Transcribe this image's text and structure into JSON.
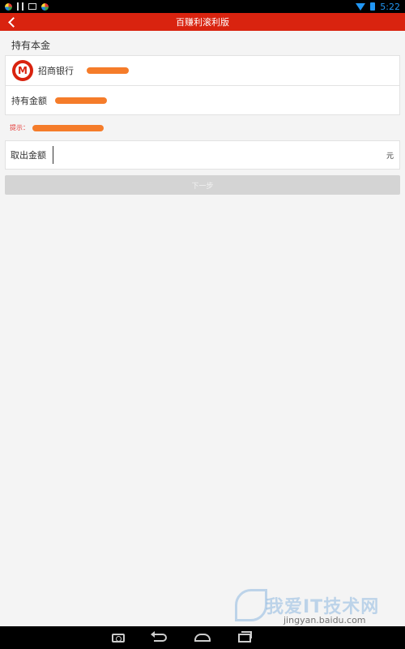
{
  "status_bar": {
    "time": "5:22",
    "icons": [
      "app-icon",
      "usb-icon",
      "image-icon",
      "app-icon",
      "wifi-icon",
      "battery-icon"
    ]
  },
  "header": {
    "title": "百赚利滚利版",
    "back_icon": "chevron-left-icon",
    "color": "#d9230f"
  },
  "section": {
    "title": "持有本金"
  },
  "bank_row": {
    "bank_name": "招商银行",
    "logo_glyph": "M",
    "logo_color": "#d9230f"
  },
  "holding_row": {
    "label": "持有金额"
  },
  "hint": {
    "label": "提示："
  },
  "withdraw_row": {
    "label": "取出金额",
    "value": "",
    "placeholder": "",
    "unit": "元"
  },
  "next_button": {
    "label": "下一步"
  },
  "watermark": {
    "text": "我爱IT技术网",
    "url": "jingyan.baidu.com"
  },
  "nav_bar": {
    "buttons": [
      "camera-icon",
      "back-icon",
      "home-icon",
      "recent-apps-icon"
    ]
  },
  "colors": {
    "redaction": "#f57c2a",
    "hint_text": "#e53935",
    "button_disabled": "#d4d4d4"
  }
}
